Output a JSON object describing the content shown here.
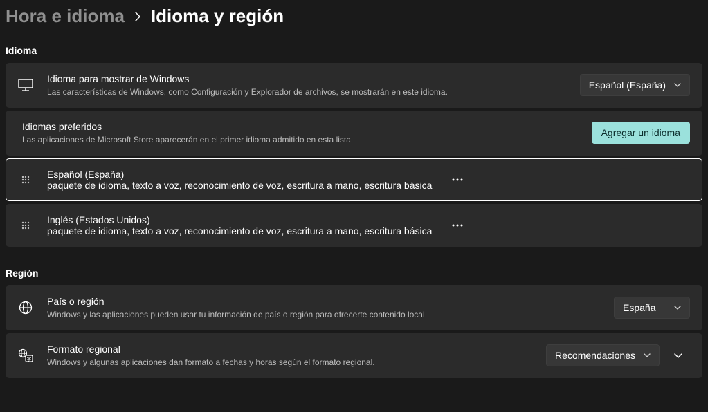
{
  "breadcrumb": {
    "parent": "Hora e idioma",
    "current": "Idioma y región"
  },
  "sections": {
    "language": "Idioma",
    "region": "Región"
  },
  "display_language": {
    "title": "Idioma para mostrar de Windows",
    "desc": "Las características de Windows, como Configuración y Explorador de archivos, se mostrarán en este idioma.",
    "selected": "Español (España)"
  },
  "preferred_languages": {
    "title": "Idiomas preferidos",
    "desc": "Las aplicaciones de Microsoft Store aparecerán en el primer idioma admitido en esta lista",
    "add_button": "Agregar un idioma",
    "items": [
      {
        "name": "Español (España)",
        "detail": "paquete de idioma, texto a voz, reconocimiento de voz, escritura a mano, escritura básica"
      },
      {
        "name": "Inglés (Estados Unidos)",
        "detail": "paquete de idioma, texto a voz, reconocimiento de voz, escritura a mano, escritura básica"
      }
    ]
  },
  "country": {
    "title": "País o región",
    "desc": "Windows y las aplicaciones pueden usar tu información de país o región para ofrecerte contenido local",
    "selected": "España"
  },
  "regional_format": {
    "title": "Formato regional",
    "desc": "Windows y algunas aplicaciones dan formato a fechas y horas según el formato regional.",
    "selected": "Recomendaciones"
  }
}
